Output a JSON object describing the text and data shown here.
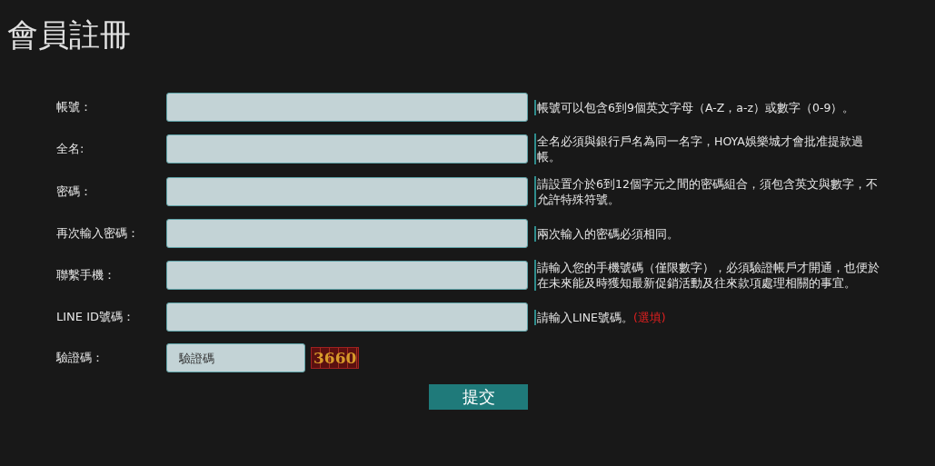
{
  "title": "會員註冊",
  "fields": [
    {
      "label": "帳號：",
      "hint": "帳號可以包含6到9個英文字母（A-Z，a-z）或數字（0-9）。"
    },
    {
      "label": "全名:",
      "hint": "全名必須與銀行戶名為同一名字，HOYA娛樂城才會批准提款過帳。"
    },
    {
      "label": "密碼：",
      "hint": "請設置介於6到12個字元之間的密碼組合，須包含英文與數字，不允許特殊符號。"
    },
    {
      "label": "再次輸入密碼：",
      "hint": "兩次輸入的密碼必須相同。"
    },
    {
      "label": "聯繫手機：",
      "hint": "請輸入您的手機號碼（僅限數字），必須驗證帳戶才開通，也便於在未來能及時獲知最新促銷活動及往來款項處理相關的事宜。"
    },
    {
      "label": "LINE ID號碼：",
      "hint": "請輸入LINE號碼。",
      "note": "(選填)"
    }
  ],
  "captcha": {
    "label": "驗證碼：",
    "placeholder": "驗證碼",
    "code": "3660"
  },
  "submit": "提交"
}
